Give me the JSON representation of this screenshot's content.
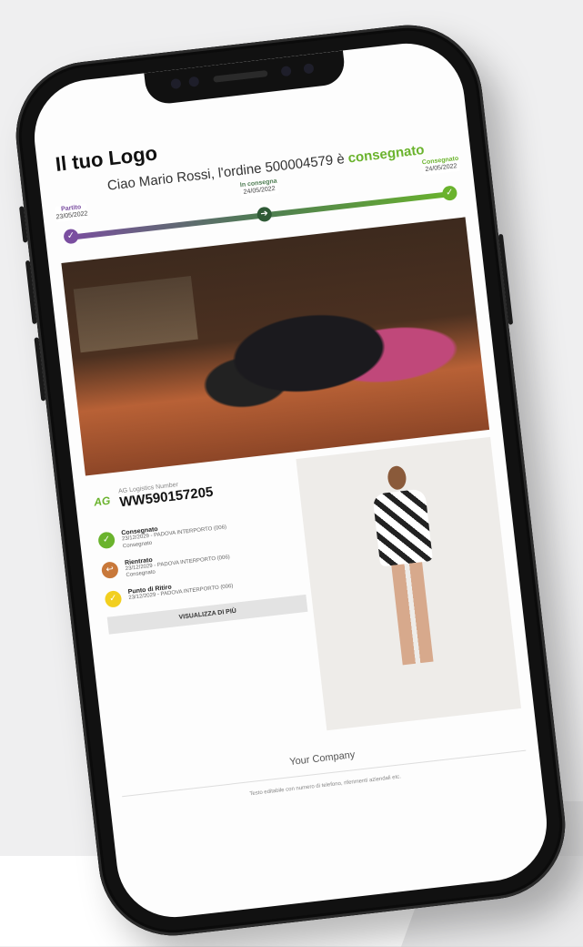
{
  "email": {
    "logo": "Il tuo Logo",
    "greeting_prefix": "Ciao Mario Rossi, l'ordine 500004579 è",
    "greeting_status": "consegnato",
    "progress": {
      "steps": [
        {
          "label": "Partito",
          "date": "23/05/2022"
        },
        {
          "label": "In consegna",
          "date": "24/05/2022"
        },
        {
          "label": "Consegnato",
          "date": "24/05/2022"
        }
      ]
    },
    "tracking": {
      "carrier_logo": "AG",
      "carrier_label": "AG Logistics Number",
      "number": "WW590157205"
    },
    "events": [
      {
        "title": "Consegnato",
        "detail": "23/12/2029 - PADOVA INTERPORTO (006)",
        "sub": "Consegnato",
        "color": "#6ab32d",
        "icon": "check-icon"
      },
      {
        "title": "Rientrato",
        "detail": "23/12/2029 - PADOVA INTERPORTO (006)",
        "sub": "Consegnato",
        "color": "#c8783a",
        "icon": "return-icon"
      },
      {
        "title": "Punto di Ritiro",
        "detail": "23/12/2029 - PADOVA INTERPORTO (006)",
        "sub": "",
        "color": "#f2cf1f",
        "icon": "pickup-icon"
      }
    ],
    "more_button": "VISUALIZZA DI PIÙ",
    "company": "Your Company",
    "footnote": "Testo editabile con numero di telefono, riferimenti aziendali etc."
  }
}
